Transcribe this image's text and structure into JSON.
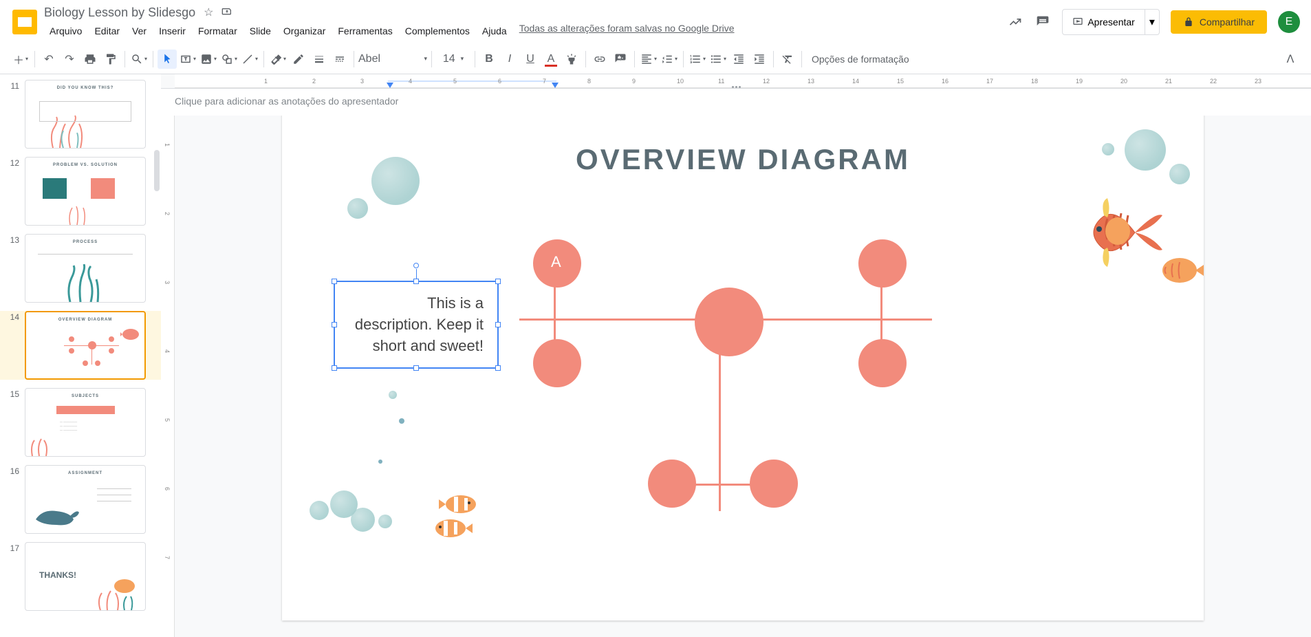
{
  "doc": {
    "title": "Biology Lesson by Slidesgo",
    "save_status": "Todas as alterações foram salvas no Google Drive"
  },
  "menus": [
    "Arquivo",
    "Editar",
    "Ver",
    "Inserir",
    "Formatar",
    "Slide",
    "Organizar",
    "Ferramentas",
    "Complementos",
    "Ajuda"
  ],
  "header": {
    "present": "Apresentar",
    "share": "Compartilhar",
    "avatar": "E"
  },
  "toolbar": {
    "font": "Abel",
    "font_size": "14",
    "format_options": "Opções de formatação"
  },
  "ruler_h": [
    "1",
    "2",
    "3",
    "4",
    "5",
    "6",
    "7",
    "8",
    "9",
    "10",
    "11",
    "12",
    "13",
    "14",
    "15",
    "16",
    "17",
    "18",
    "19",
    "20",
    "21",
    "22",
    "23"
  ],
  "ruler_v": [
    "1",
    "2",
    "3",
    "4",
    "5",
    "6",
    "7"
  ],
  "slide": {
    "title": "OVERVIEW DIAGRAM",
    "textbox": "This is a description. Keep it short and sweet!",
    "node_a": "A"
  },
  "thumbs": [
    {
      "num": "11",
      "title": "DID YOU KNOW THIS?"
    },
    {
      "num": "12",
      "title": "PROBLEM VS. SOLUTION"
    },
    {
      "num": "13",
      "title": "PROCESS"
    },
    {
      "num": "14",
      "title": "OVERVIEW DIAGRAM"
    },
    {
      "num": "15",
      "title": "SUBJECTS"
    },
    {
      "num": "16",
      "title": "ASSIGNMENT"
    },
    {
      "num": "17",
      "title": "THANKS!"
    }
  ],
  "notes": {
    "placeholder": "Clique para adicionar as anotações do apresentador"
  },
  "colors": {
    "coral": "#f28b7c",
    "teal_dark": "#5a6b73",
    "share_yellow": "#fbbc04"
  }
}
